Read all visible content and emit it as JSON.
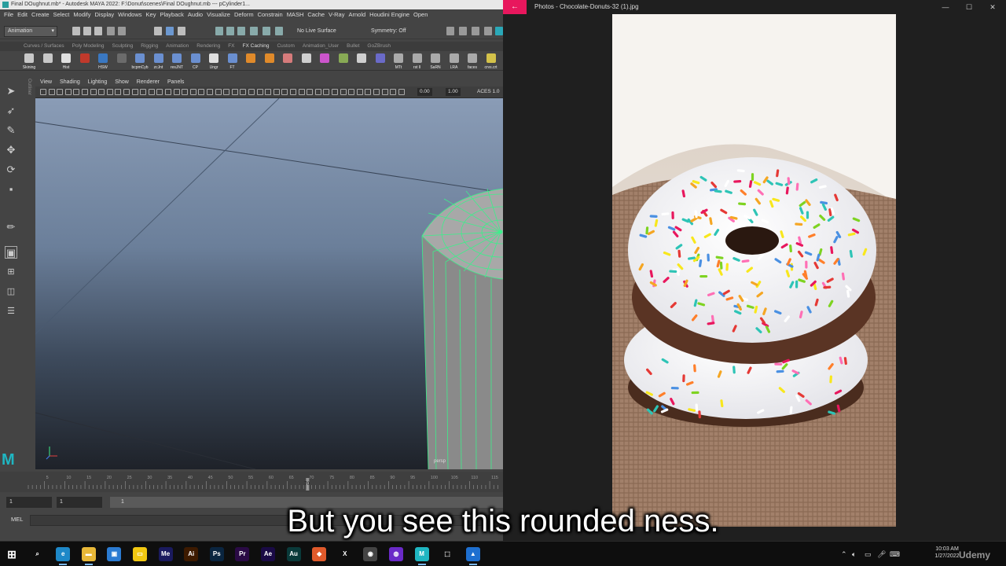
{
  "maya": {
    "title": "Final DOughnut.mb* - Autodesk MAYA 2022: F:\\Donut\\scenes\\Final DOughnut.mb  ---  pCylinder1...",
    "menus": [
      "File",
      "Edit",
      "Create",
      "Select",
      "Modify",
      "Display",
      "Windows",
      "Key",
      "Playback",
      "Audio",
      "Visualize",
      "Deform",
      "Constrain",
      "MASH",
      "Cache",
      "V-Ray",
      "Arnold",
      "Houdini Engine",
      "Open"
    ],
    "mode": "Animation",
    "live_surface": "No Live Surface",
    "symmetry": "Symmetry: Off",
    "shelf_tabs": [
      "Curves / Surfaces",
      "Poly Modeling",
      "Sculpting",
      "Rigging",
      "Animation",
      "Rendering",
      "FX",
      "FX Caching",
      "Custom",
      "Animation_User",
      "Bullet",
      "GoZBrush"
    ],
    "shelf_buttons": [
      {
        "label": "Skining",
        "color": "#c8c8c8"
      },
      {
        "label": "",
        "color": "#c8c8c8"
      },
      {
        "label": "Hist",
        "color": "#e0e0e0"
      },
      {
        "label": "",
        "color": "#c0392b"
      },
      {
        "label": "HSW",
        "color": "#3a78c2"
      },
      {
        "label": "",
        "color": "#6b6b6b"
      },
      {
        "label": "bcpmCyb",
        "color": "#6a8fd0"
      },
      {
        "label": "zcJnt",
        "color": "#6a8fd0"
      },
      {
        "label": "resJNT",
        "color": "#6a8fd0"
      },
      {
        "label": "CP",
        "color": "#6a8fd0"
      },
      {
        "label": "Ungr",
        "color": "#e0e0e0"
      },
      {
        "label": "FT",
        "color": "#6a8fd0"
      },
      {
        "label": "",
        "color": "#e08a2a"
      },
      {
        "label": "",
        "color": "#e08a2a"
      },
      {
        "label": "",
        "color": "#d67b7b"
      },
      {
        "label": "",
        "color": "#cfcfcf"
      },
      {
        "label": "",
        "color": "#cc55cc"
      },
      {
        "label": "",
        "color": "#88aa55"
      },
      {
        "label": "",
        "color": "#cfcfcf"
      },
      {
        "label": "",
        "color": "#6a6ac8"
      },
      {
        "label": "MTt",
        "color": "#aaaaaa"
      },
      {
        "label": "rst ll",
        "color": "#aaaaaa"
      },
      {
        "label": "SaRN",
        "color": "#aaaaaa"
      },
      {
        "label": "LRA",
        "color": "#aaaaaa"
      },
      {
        "label": "faces",
        "color": "#aaaaaa"
      },
      {
        "label": "crvs.crt",
        "color": "#d4c24a"
      }
    ],
    "panel_menus": [
      "View",
      "Shading",
      "Lighting",
      "Show",
      "Renderer",
      "Panels"
    ],
    "exposure": "0.00",
    "gamma": "1.00",
    "color_space": "ACES 1.0",
    "camera": "persp",
    "current_frame": "70",
    "ticks": [
      "5",
      "10",
      "15",
      "20",
      "25",
      "30",
      "35",
      "40",
      "45",
      "50",
      "55",
      "60",
      "65",
      "70",
      "75",
      "80",
      "85",
      "90",
      "95",
      "100",
      "105",
      "110",
      "115"
    ],
    "range_start": "1",
    "range_start_inner": "1",
    "range_slider": "1",
    "mel_label": "MEL"
  },
  "photos": {
    "title": "Photos - Chocolate-Donuts-32 (1).jpg",
    "back_icon": "←",
    "minimize": "—",
    "maximize": "☐",
    "close": "✕"
  },
  "subtitle": "But you see this rounded ness.",
  "taskbar": {
    "apps": [
      {
        "name": "windows-start",
        "glyph": "⊞",
        "bg": "transparent"
      },
      {
        "name": "search",
        "glyph": "⌕",
        "bg": "transparent"
      },
      {
        "name": "edge",
        "glyph": "e",
        "bg": "#1e88c8"
      },
      {
        "name": "file-explorer",
        "glyph": "▬",
        "bg": "#e8b838"
      },
      {
        "name": "store",
        "glyph": "▣",
        "bg": "#2b7bd2"
      },
      {
        "name": "sticky-notes",
        "glyph": "▭",
        "bg": "#f2c811"
      },
      {
        "name": "media-encoder",
        "glyph": "Me",
        "bg": "#1a1a5e"
      },
      {
        "name": "illustrator",
        "glyph": "Ai",
        "bg": "#3d1a00"
      },
      {
        "name": "photoshop",
        "glyph": "Ps",
        "bg": "#0a2540"
      },
      {
        "name": "premiere",
        "glyph": "Pr",
        "bg": "#2a0a45"
      },
      {
        "name": "after-effects",
        "glyph": "Ae",
        "bg": "#1a0a45"
      },
      {
        "name": "audition",
        "glyph": "Au",
        "bg": "#0a3a3a"
      },
      {
        "name": "substance",
        "glyph": "◆",
        "bg": "#e05a2b"
      },
      {
        "name": "x-app",
        "glyph": "X",
        "bg": "transparent"
      },
      {
        "name": "davinci",
        "glyph": "◉",
        "bg": "#444444"
      },
      {
        "name": "obs",
        "glyph": "◍",
        "bg": "#6a2ac8"
      },
      {
        "name": "maya",
        "glyph": "M",
        "bg": "#1fb6c2"
      },
      {
        "name": "snipping",
        "glyph": "⬚",
        "bg": "transparent"
      },
      {
        "name": "photos",
        "glyph": "▲",
        "bg": "#1e6fd0"
      }
    ],
    "time": "10:03 AM",
    "date": "1/27/2022",
    "watermark": "Udemy"
  }
}
